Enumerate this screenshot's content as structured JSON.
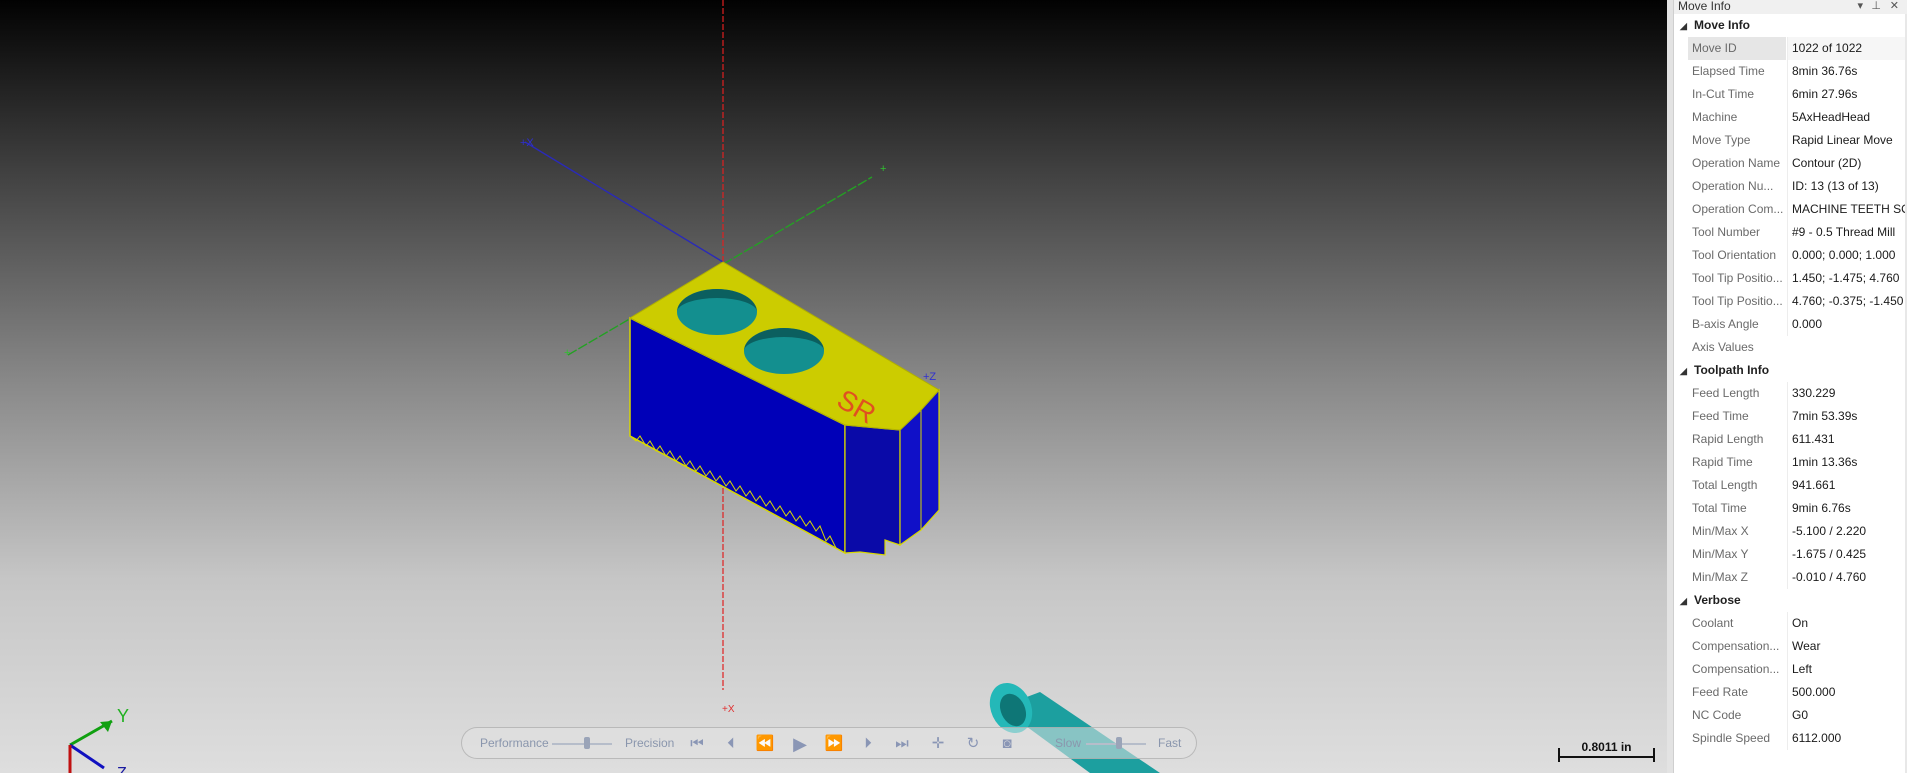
{
  "viewport": {
    "axis_labels": {
      "z": "+Z",
      "x": "+X",
      "y": "+Y",
      "xx": "+X"
    },
    "part_text": "SR",
    "triad": {
      "y": "Y",
      "z": "Z"
    },
    "scale_label": "0.8011 in",
    "colors": {
      "top_face": "#cccc00",
      "side_face": "#0000b8",
      "hole": "#138f8f",
      "tool": "#1c9f9f",
      "z_axis": "#e02020",
      "x_axis": "#2020c0",
      "y_axis": "#20b020"
    }
  },
  "playback": {
    "performance": "Performance",
    "precision": "Precision",
    "slow": "Slow",
    "fast": "Fast",
    "icons": [
      "first-icon",
      "step-back-icon",
      "rewind-icon",
      "play-icon",
      "fast-forward-icon",
      "step-forward-icon",
      "last-icon",
      "pin-toolpath-icon",
      "loop-icon",
      "stop-icon"
    ]
  },
  "panel": {
    "title": "Move Info",
    "sections": [
      {
        "name": "Move Info",
        "rows": [
          {
            "label": "Move ID",
            "value": "1022 of 1022"
          },
          {
            "label": "Elapsed Time",
            "value": "8min 36.76s"
          },
          {
            "label": "In-Cut Time",
            "value": "6min 27.96s"
          },
          {
            "label": "Machine",
            "value": "5AxHeadHead"
          },
          {
            "label": "Move Type",
            "value": "Rapid Linear Move"
          },
          {
            "label": "Operation Name",
            "value": "Contour (2D)"
          },
          {
            "label": "Operation Nu...",
            "value": "ID: 13 (13 of 13)"
          },
          {
            "label": "Operation Com...",
            "value": "MACHINE TEETH SOI"
          },
          {
            "label": "Tool Number",
            "value": "#9 - 0.5 Thread Mill"
          },
          {
            "label": "Tool Orientation",
            "value": "0.000; 0.000; 1.000"
          },
          {
            "label": "Tool Tip Positio...",
            "value": "1.450; -1.475; 4.760"
          },
          {
            "label": "Tool Tip Positio...",
            "value": "4.760; -0.375; -1.450"
          },
          {
            "label": "B-axis Angle",
            "value": "0.000"
          },
          {
            "label": "Axis Values",
            "value": ""
          }
        ]
      },
      {
        "name": "Toolpath Info",
        "rows": [
          {
            "label": "Feed Length",
            "value": "330.229"
          },
          {
            "label": "Feed Time",
            "value": "7min 53.39s"
          },
          {
            "label": "Rapid Length",
            "value": "611.431"
          },
          {
            "label": "Rapid Time",
            "value": "1min 13.36s"
          },
          {
            "label": "Total Length",
            "value": "941.661"
          },
          {
            "label": "Total Time",
            "value": "9min 6.76s"
          },
          {
            "label": "Min/Max X",
            "value": "-5.100 / 2.220"
          },
          {
            "label": "Min/Max Y",
            "value": "-1.675 / 0.425"
          },
          {
            "label": "Min/Max Z",
            "value": "-0.010 / 4.760"
          }
        ]
      },
      {
        "name": "Verbose",
        "rows": [
          {
            "label": "Coolant",
            "value": "On"
          },
          {
            "label": "Compensation...",
            "value": "Wear"
          },
          {
            "label": "Compensation...",
            "value": "Left"
          },
          {
            "label": "Feed Rate",
            "value": "500.000"
          },
          {
            "label": "NC Code",
            "value": "G0"
          },
          {
            "label": "Spindle Speed",
            "value": "6112.000"
          }
        ]
      }
    ]
  }
}
